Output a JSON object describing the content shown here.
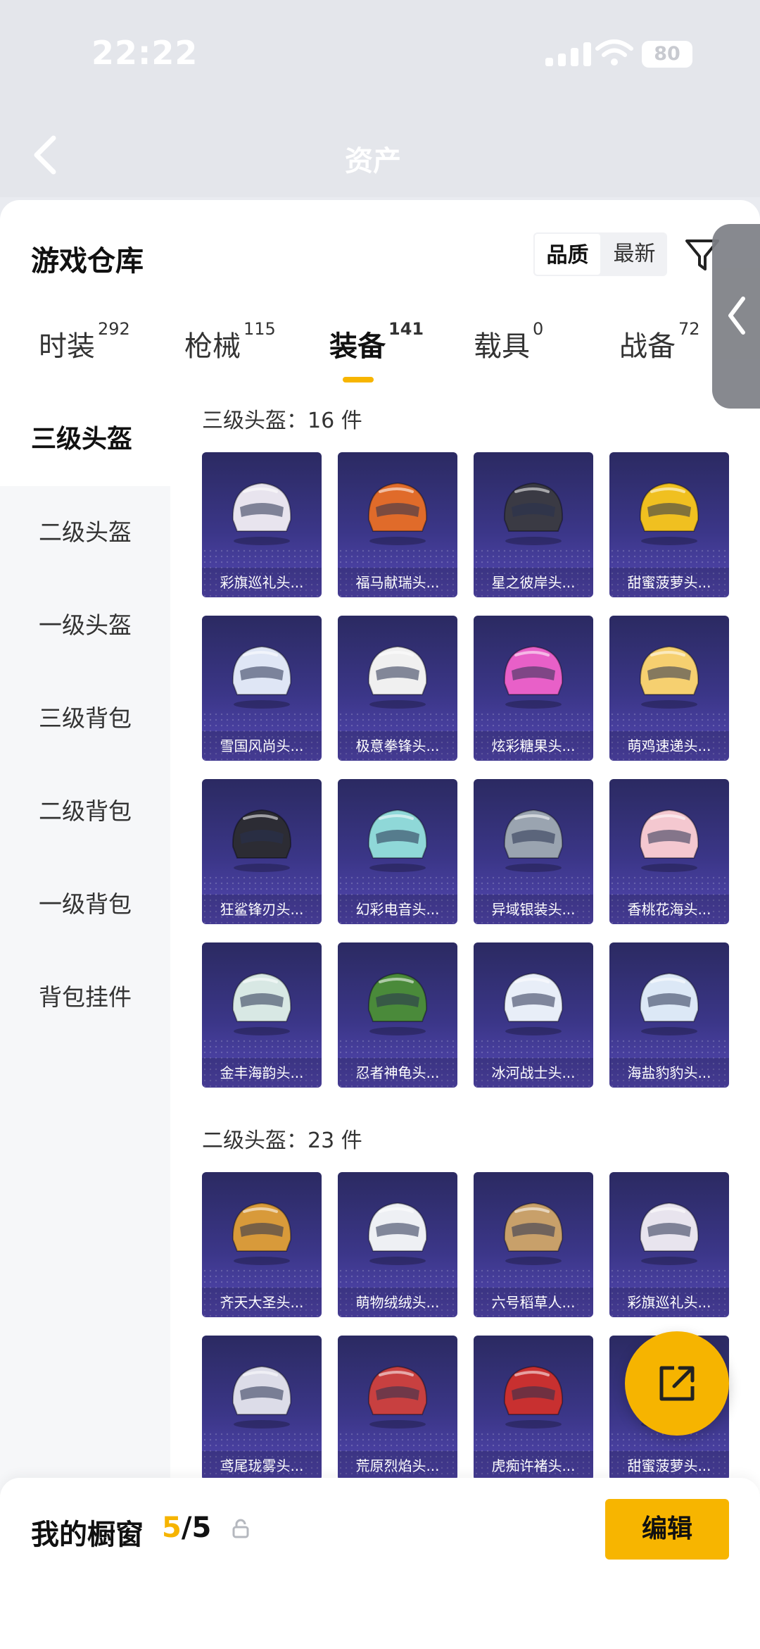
{
  "status": {
    "time": "22:22",
    "battery": "80"
  },
  "header": {
    "blurred_title": "资产"
  },
  "panel": {
    "title": "游戏仓库",
    "sort": {
      "options": [
        "品质",
        "最新"
      ],
      "selected": "品质"
    }
  },
  "tabs": [
    {
      "label": "时装",
      "count": "292"
    },
    {
      "label": "枪械",
      "count": "115"
    },
    {
      "label": "装备",
      "count": "141",
      "active": true
    },
    {
      "label": "载具",
      "count": "0"
    },
    {
      "label": "战备",
      "count": "72"
    }
  ],
  "sidebar": {
    "items": [
      "三级头盔",
      "二级头盔",
      "一级头盔",
      "三级背包",
      "二级背包",
      "一级背包",
      "背包挂件"
    ],
    "active_index": 0
  },
  "sections": [
    {
      "title": "三级头盔：16 件",
      "items": [
        {
          "name": "彩旗巡礼头...",
          "color": "#e8e4ee"
        },
        {
          "name": "福马献瑞头...",
          "color": "#e06b2a"
        },
        {
          "name": "星之彼岸头...",
          "color": "#3a3a44"
        },
        {
          "name": "甜蜜菠萝头...",
          "color": "#f0c020"
        },
        {
          "name": "雪国风尚头...",
          "color": "#dfe6f5"
        },
        {
          "name": "极意拳锋头...",
          "color": "#f0f0f0"
        },
        {
          "name": "炫彩糖果头...",
          "color": "#e860c8"
        },
        {
          "name": "萌鸡速递头...",
          "color": "#f6d070"
        },
        {
          "name": "狂鲨锋刃头...",
          "color": "#2c2c34"
        },
        {
          "name": "幻彩电音头...",
          "color": "#8fd8d8"
        },
        {
          "name": "异域银装头...",
          "color": "#9aa4b0"
        },
        {
          "name": "香桃花海头...",
          "color": "#f4c8d0"
        },
        {
          "name": "金丰海韵头...",
          "color": "#d8e8e4"
        },
        {
          "name": "忍者神龟头...",
          "color": "#4a8a3a"
        },
        {
          "name": "冰河战士头...",
          "color": "#e8eef8"
        },
        {
          "name": "海盐豹豹头...",
          "color": "#dce8f6"
        }
      ]
    },
    {
      "title": "二级头盔：23 件",
      "items": [
        {
          "name": "齐天大圣头...",
          "color": "#d89a3a"
        },
        {
          "name": "萌物绒绒头...",
          "color": "#eef0f4"
        },
        {
          "name": "六号稻草人...",
          "color": "#c8a06a"
        },
        {
          "name": "彩旗巡礼头...",
          "color": "#e8e4ee"
        },
        {
          "name": "鸢尾珑雾头...",
          "color": "#dcdce8"
        },
        {
          "name": "荒原烈焰头...",
          "color": "#c84040"
        },
        {
          "name": "虎痴许褚头...",
          "color": "#c83030"
        },
        {
          "name": "甜蜜菠萝头...",
          "color": "#f0c020"
        }
      ]
    }
  ],
  "bottom": {
    "title": "我的橱窗",
    "count_current": "5",
    "count_total": "/5",
    "edit_label": "编辑"
  },
  "colors": {
    "accent": "#f7b500",
    "card_top": "#2b2a62",
    "card_bottom": "#5448b3"
  }
}
